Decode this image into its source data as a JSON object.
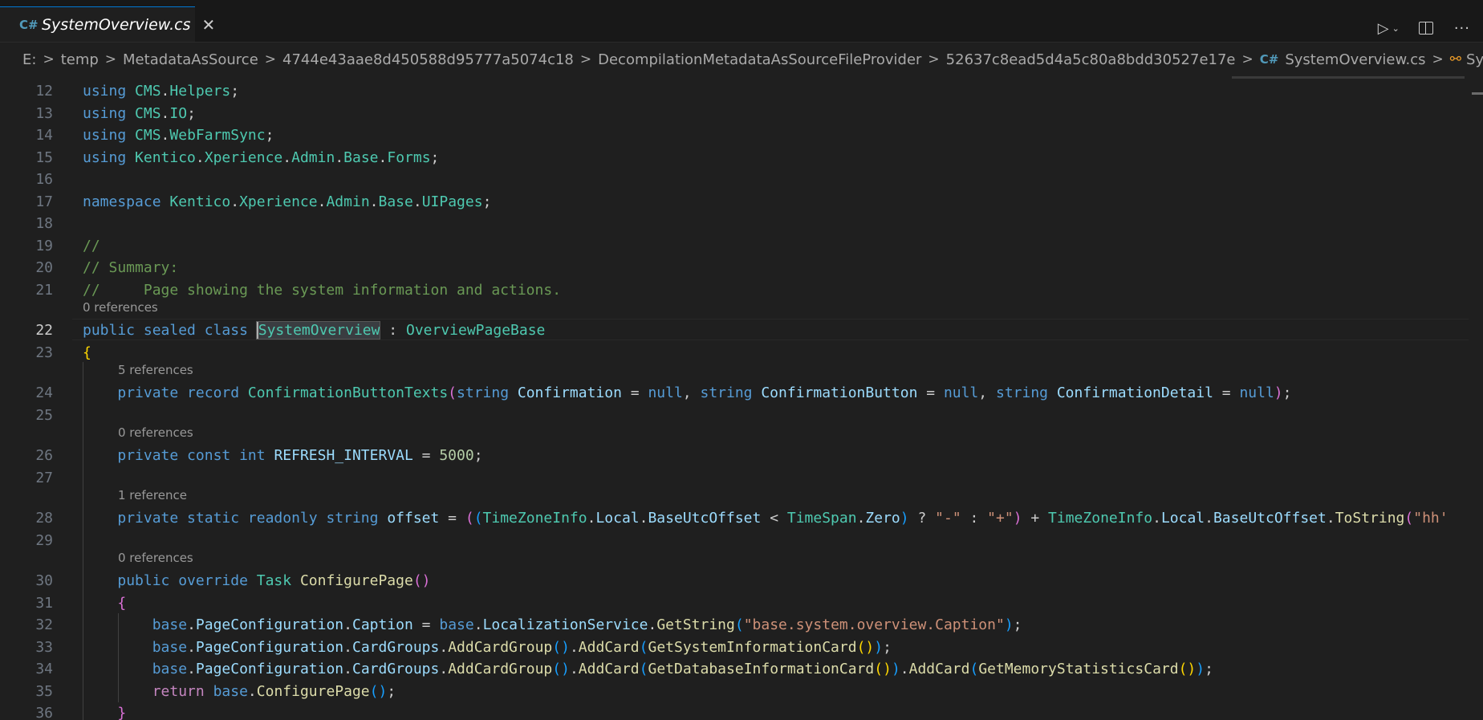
{
  "tab": {
    "icon": "csharp-file-icon",
    "label": "SystemOverview.cs",
    "close": "✕"
  },
  "actions": {
    "run": "▷",
    "dropdown": "⌄",
    "more": "···"
  },
  "breadcrumb": {
    "items": [
      "E:",
      "temp",
      "MetadataAsSource",
      "4744e43aae8d450588d95777a5074c18",
      "DecompilationMetadataAsSourceFileProvider",
      "52637c8ead5d4a5c80a8bdd30527e17e"
    ],
    "file": "SystemOverview.cs",
    "symbol": "SystemOverview",
    "separator": ">"
  },
  "lines": [
    {
      "n": "12",
      "tokens": [
        [
          "kw",
          "using "
        ],
        [
          "ty",
          "CMS"
        ],
        [
          "pl",
          "."
        ],
        [
          "ty",
          "Helpers"
        ],
        [
          "pl",
          ";"
        ]
      ]
    },
    {
      "n": "13",
      "tokens": [
        [
          "kw",
          "using "
        ],
        [
          "ty",
          "CMS"
        ],
        [
          "pl",
          "."
        ],
        [
          "ty",
          "IO"
        ],
        [
          "pl",
          ";"
        ]
      ]
    },
    {
      "n": "14",
      "tokens": [
        [
          "kw",
          "using "
        ],
        [
          "ty",
          "CMS"
        ],
        [
          "pl",
          "."
        ],
        [
          "ty",
          "WebFarmSync"
        ],
        [
          "pl",
          ";"
        ]
      ]
    },
    {
      "n": "15",
      "tokens": [
        [
          "kw",
          "using "
        ],
        [
          "ty",
          "Kentico"
        ],
        [
          "pl",
          "."
        ],
        [
          "ty",
          "Xperience"
        ],
        [
          "pl",
          "."
        ],
        [
          "ty",
          "Admin"
        ],
        [
          "pl",
          "."
        ],
        [
          "ty",
          "Base"
        ],
        [
          "pl",
          "."
        ],
        [
          "ty",
          "Forms"
        ],
        [
          "pl",
          ";"
        ]
      ]
    },
    {
      "n": "16",
      "tokens": []
    },
    {
      "n": "17",
      "tokens": [
        [
          "kw",
          "namespace "
        ],
        [
          "ty",
          "Kentico"
        ],
        [
          "pl",
          "."
        ],
        [
          "ty",
          "Xperience"
        ],
        [
          "pl",
          "."
        ],
        [
          "ty",
          "Admin"
        ],
        [
          "pl",
          "."
        ],
        [
          "ty",
          "Base"
        ],
        [
          "pl",
          "."
        ],
        [
          "ty",
          "UIPages"
        ],
        [
          "pl",
          ";"
        ]
      ]
    },
    {
      "n": "18",
      "tokens": []
    },
    {
      "n": "19",
      "tokens": [
        [
          "cm",
          "//"
        ]
      ]
    },
    {
      "n": "20",
      "tokens": [
        [
          "cm",
          "// Summary:"
        ]
      ]
    },
    {
      "n": "21",
      "tokens": [
        [
          "cm",
          "//     Page showing the system information and actions."
        ]
      ]
    },
    {
      "n": "22",
      "lens": "0 references",
      "tokens": [
        [
          "kw",
          "public sealed class "
        ],
        [
          "sel",
          "SystemOverview"
        ],
        [
          "pl",
          " : "
        ],
        [
          "ty",
          "OverviewPageBase"
        ]
      ]
    },
    {
      "n": "23",
      "tokens": [
        [
          "b1",
          "{"
        ]
      ]
    },
    {
      "n": "24",
      "lens": "5 references",
      "tokens": [
        [
          "pl",
          "    "
        ],
        [
          "kw",
          "private record "
        ],
        [
          "ty",
          "ConfirmationButtonTexts"
        ],
        [
          "b2",
          "("
        ],
        [
          "kw",
          "string "
        ],
        [
          "pr",
          "Confirmation"
        ],
        [
          "pl",
          " = "
        ],
        [
          "kw",
          "null"
        ],
        [
          "pl",
          ", "
        ],
        [
          "kw",
          "string "
        ],
        [
          "pr",
          "ConfirmationButton"
        ],
        [
          "pl",
          " = "
        ],
        [
          "kw",
          "null"
        ],
        [
          "pl",
          ", "
        ],
        [
          "kw",
          "string "
        ],
        [
          "pr",
          "ConfirmationDetail"
        ],
        [
          "pl",
          " = "
        ],
        [
          "kw",
          "null"
        ],
        [
          "b2",
          ")"
        ],
        [
          "pl",
          ";"
        ]
      ]
    },
    {
      "n": "25",
      "tokens": []
    },
    {
      "n": "26",
      "lens": "0 references",
      "tokens": [
        [
          "pl",
          "    "
        ],
        [
          "kw",
          "private const int "
        ],
        [
          "pr",
          "REFRESH_INTERVAL"
        ],
        [
          "pl",
          " = "
        ],
        [
          "nu",
          "5000"
        ],
        [
          "pl",
          ";"
        ]
      ]
    },
    {
      "n": "27",
      "tokens": []
    },
    {
      "n": "28",
      "lens": "1 reference",
      "tokens": [
        [
          "pl",
          "    "
        ],
        [
          "kw",
          "private static readonly string "
        ],
        [
          "pr",
          "offset"
        ],
        [
          "pl",
          " = "
        ],
        [
          "b2",
          "("
        ],
        [
          "b3",
          "("
        ],
        [
          "ty",
          "TimeZoneInfo"
        ],
        [
          "pl",
          "."
        ],
        [
          "pr",
          "Local"
        ],
        [
          "pl",
          "."
        ],
        [
          "pr",
          "BaseUtcOffset"
        ],
        [
          "pl",
          " < "
        ],
        [
          "ty",
          "TimeSpan"
        ],
        [
          "pl",
          "."
        ],
        [
          "pr",
          "Zero"
        ],
        [
          "b3",
          ")"
        ],
        [
          "pl",
          " ? "
        ],
        [
          "st",
          "\"-\""
        ],
        [
          "pl",
          " : "
        ],
        [
          "st",
          "\"+\""
        ],
        [
          "b2",
          ")"
        ],
        [
          "pl",
          " + "
        ],
        [
          "ty",
          "TimeZoneInfo"
        ],
        [
          "pl",
          "."
        ],
        [
          "pr",
          "Local"
        ],
        [
          "pl",
          "."
        ],
        [
          "pr",
          "BaseUtcOffset"
        ],
        [
          "pl",
          "."
        ],
        [
          "fn",
          "ToString"
        ],
        [
          "b2",
          "("
        ],
        [
          "st",
          "\"hh'"
        ]
      ]
    },
    {
      "n": "29",
      "tokens": []
    },
    {
      "n": "30",
      "lens": "0 references",
      "tokens": [
        [
          "pl",
          "    "
        ],
        [
          "kw",
          "public override "
        ],
        [
          "ty",
          "Task "
        ],
        [
          "fn",
          "ConfigurePage"
        ],
        [
          "b2",
          "()"
        ]
      ]
    },
    {
      "n": "31",
      "tokens": [
        [
          "pl",
          "    "
        ],
        [
          "b2",
          "{"
        ]
      ]
    },
    {
      "n": "32",
      "tokens": [
        [
          "pl",
          "        "
        ],
        [
          "kw",
          "base"
        ],
        [
          "pl",
          "."
        ],
        [
          "pr",
          "PageConfiguration"
        ],
        [
          "pl",
          "."
        ],
        [
          "pr",
          "Caption"
        ],
        [
          "pl",
          " = "
        ],
        [
          "kw",
          "base"
        ],
        [
          "pl",
          "."
        ],
        [
          "pr",
          "LocalizationService"
        ],
        [
          "pl",
          "."
        ],
        [
          "fn",
          "GetString"
        ],
        [
          "b3",
          "("
        ],
        [
          "st",
          "\"base.system.overview.Caption\""
        ],
        [
          "b3",
          ")"
        ],
        [
          "pl",
          ";"
        ]
      ]
    },
    {
      "n": "33",
      "tokens": [
        [
          "pl",
          "        "
        ],
        [
          "kw",
          "base"
        ],
        [
          "pl",
          "."
        ],
        [
          "pr",
          "PageConfiguration"
        ],
        [
          "pl",
          "."
        ],
        [
          "pr",
          "CardGroups"
        ],
        [
          "pl",
          "."
        ],
        [
          "fn",
          "AddCardGroup"
        ],
        [
          "b3",
          "()"
        ],
        [
          "pl",
          "."
        ],
        [
          "fn",
          "AddCard"
        ],
        [
          "b3",
          "("
        ],
        [
          "fn",
          "GetSystemInformationCard"
        ],
        [
          "b1",
          "()"
        ],
        [
          "b3",
          ")"
        ],
        [
          "pl",
          ";"
        ]
      ]
    },
    {
      "n": "34",
      "tokens": [
        [
          "pl",
          "        "
        ],
        [
          "kw",
          "base"
        ],
        [
          "pl",
          "."
        ],
        [
          "pr",
          "PageConfiguration"
        ],
        [
          "pl",
          "."
        ],
        [
          "pr",
          "CardGroups"
        ],
        [
          "pl",
          "."
        ],
        [
          "fn",
          "AddCardGroup"
        ],
        [
          "b3",
          "()"
        ],
        [
          "pl",
          "."
        ],
        [
          "fn",
          "AddCard"
        ],
        [
          "b3",
          "("
        ],
        [
          "fn",
          "GetDatabaseInformationCard"
        ],
        [
          "b1",
          "()"
        ],
        [
          "b3",
          ")"
        ],
        [
          "pl",
          "."
        ],
        [
          "fn",
          "AddCard"
        ],
        [
          "b3",
          "("
        ],
        [
          "fn",
          "GetMemoryStatisticsCard"
        ],
        [
          "b1",
          "()"
        ],
        [
          "b3",
          ")"
        ],
        [
          "pl",
          ";"
        ]
      ]
    },
    {
      "n": "35",
      "tokens": [
        [
          "pl",
          "        "
        ],
        [
          "ctl",
          "return "
        ],
        [
          "kw",
          "base"
        ],
        [
          "pl",
          "."
        ],
        [
          "fn",
          "ConfigurePage"
        ],
        [
          "b3",
          "()"
        ],
        [
          "pl",
          ";"
        ]
      ]
    },
    {
      "n": "36",
      "tokens": [
        [
          "pl",
          "    "
        ],
        [
          "b2",
          "}"
        ]
      ]
    }
  ],
  "active_line": "22"
}
